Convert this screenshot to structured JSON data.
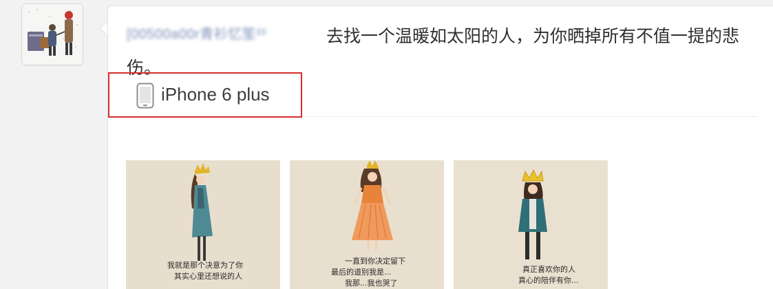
{
  "post": {
    "username": "[00500a00r青衫忆笙²³",
    "message": "去找一个温暖如太阳的人，为你晒掉所有不值一提的悲伤。",
    "device": {
      "label": "iPhone 6 plus",
      "icon": "phone-icon"
    },
    "highlight_color": "#d62d30",
    "images": [
      {
        "caption_line1": "我就是那个决意为了你",
        "caption_line2": "其实心里还想说的人"
      },
      {
        "caption_line1": "一直到你决定留下",
        "caption_line2": "最后的道别我是...",
        "caption_line3": "我那...我也哭了"
      },
      {
        "caption_line1": "真正喜欢你的人",
        "caption_line2": "真心的陪伴有你..."
      }
    ]
  }
}
